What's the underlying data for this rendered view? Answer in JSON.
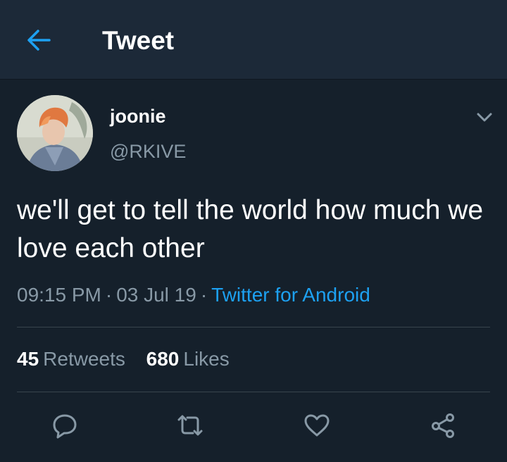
{
  "header": {
    "back_icon": "arrow-left-icon",
    "title": "Tweet"
  },
  "tweet": {
    "author": {
      "display_name": "joonie",
      "handle": "@RKIVE"
    },
    "text": "we'll get to tell the world how much we love each other",
    "time": "09:15 PM",
    "separator": "·",
    "date": "03 Jul 19",
    "source": "Twitter for Android",
    "stats": {
      "retweets_count": "45",
      "retweets_label": "Retweets",
      "likes_count": "680",
      "likes_label": "Likes"
    },
    "actions": [
      "reply-icon",
      "retweet-icon",
      "like-icon",
      "share-icon"
    ]
  },
  "colors": {
    "background": "#15202b",
    "header_background": "#1c2938",
    "accent": "#1da1f2",
    "secondary_text": "#8899a6"
  }
}
